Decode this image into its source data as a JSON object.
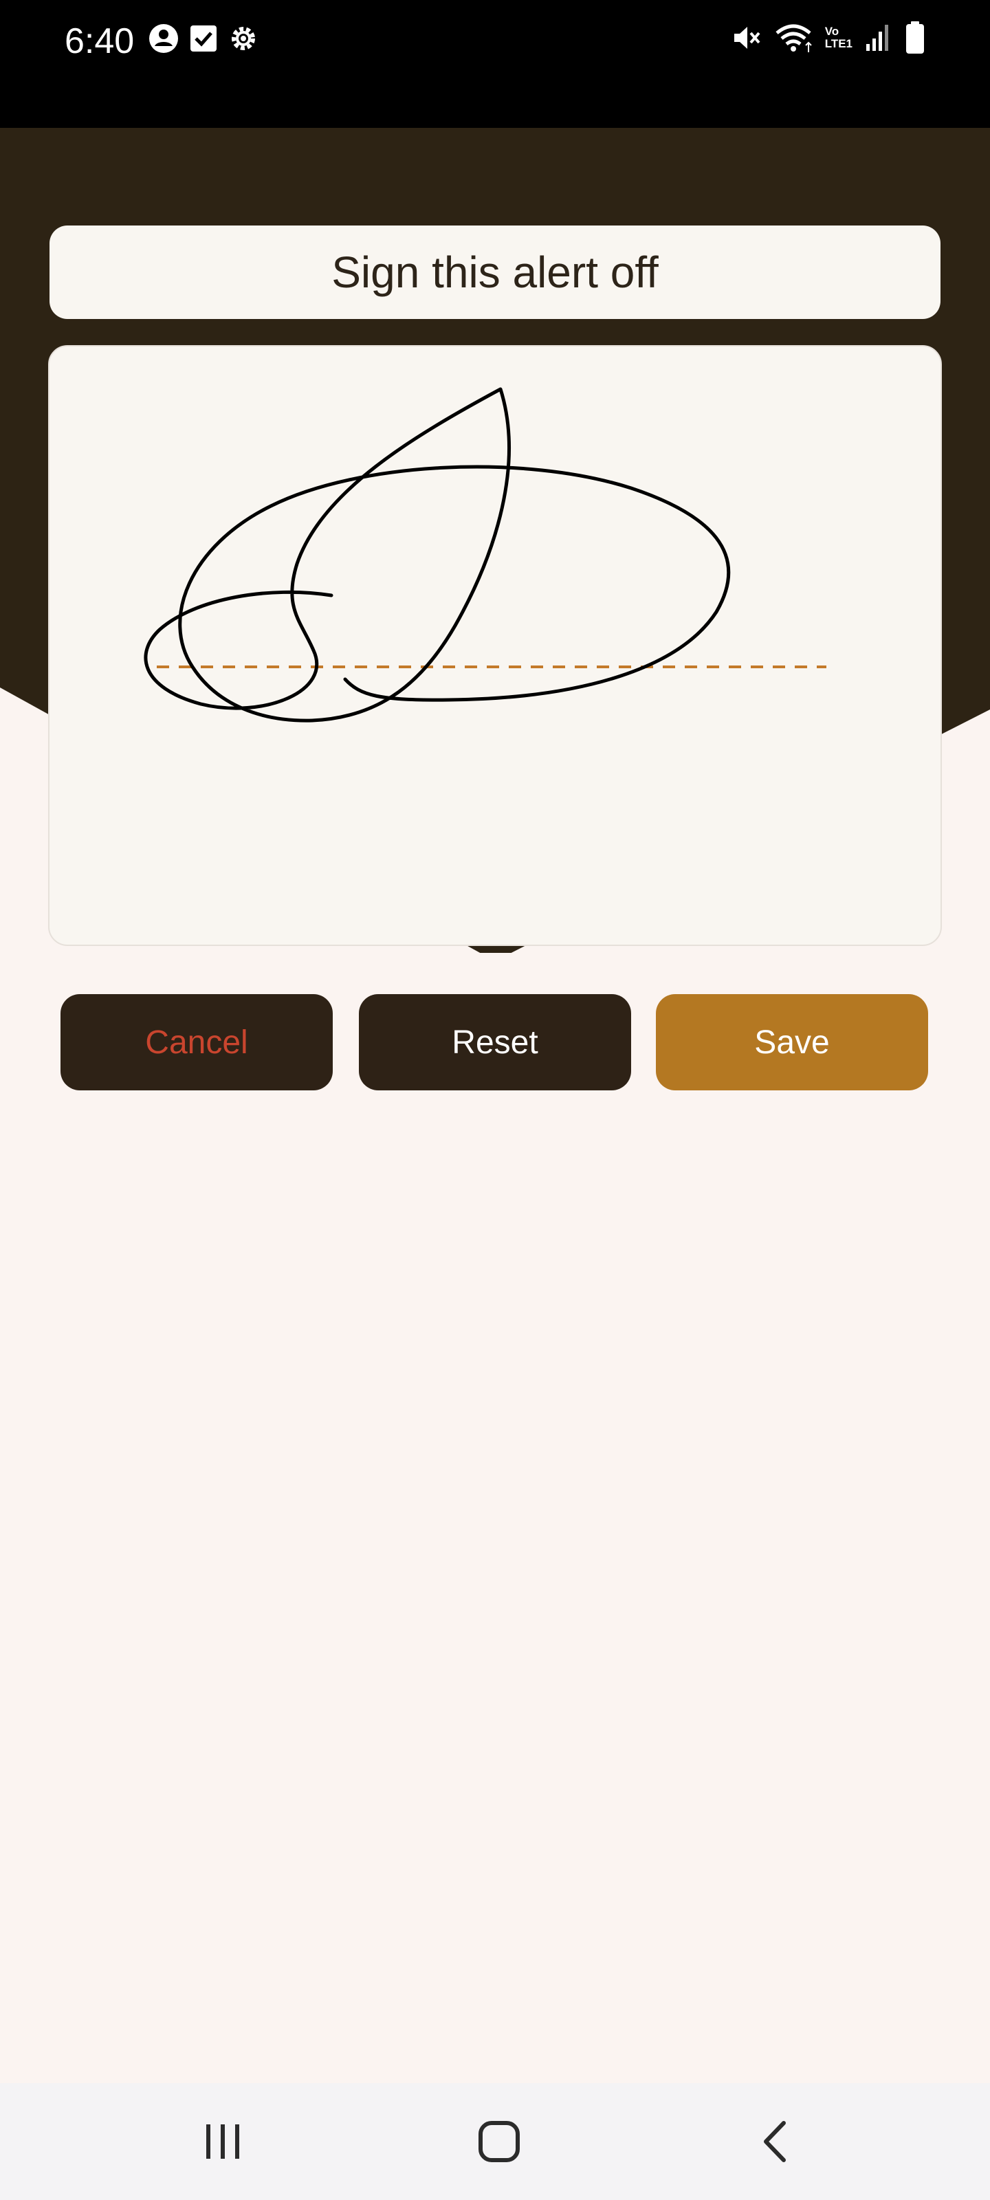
{
  "status_bar": {
    "time": "6:40",
    "left_icons": [
      "account-circle-icon",
      "checkbox-icon",
      "settings-gear-icon"
    ],
    "right_icons": [
      "mute-icon",
      "wifi-icon",
      "volte-icon",
      "signal-icon",
      "battery-icon"
    ],
    "volte_label_top": "Vo",
    "volte_label_bottom": "LTE1"
  },
  "title": "Sign this alert off",
  "signature_pad": {
    "has_signature": true,
    "baseline_style": "dashed",
    "baseline_color": "#c47a2a"
  },
  "buttons": {
    "cancel": "Cancel",
    "reset": "Reset",
    "save": "Save"
  },
  "nav_bar": {
    "items": [
      "recent-apps-icon",
      "home-icon",
      "back-icon"
    ]
  },
  "colors": {
    "header_dark": "#2d2314",
    "page_background": "#fbf4f1",
    "card_background": "#f9f6f1",
    "accent": "#b47822",
    "cancel_text": "#c9452e"
  }
}
